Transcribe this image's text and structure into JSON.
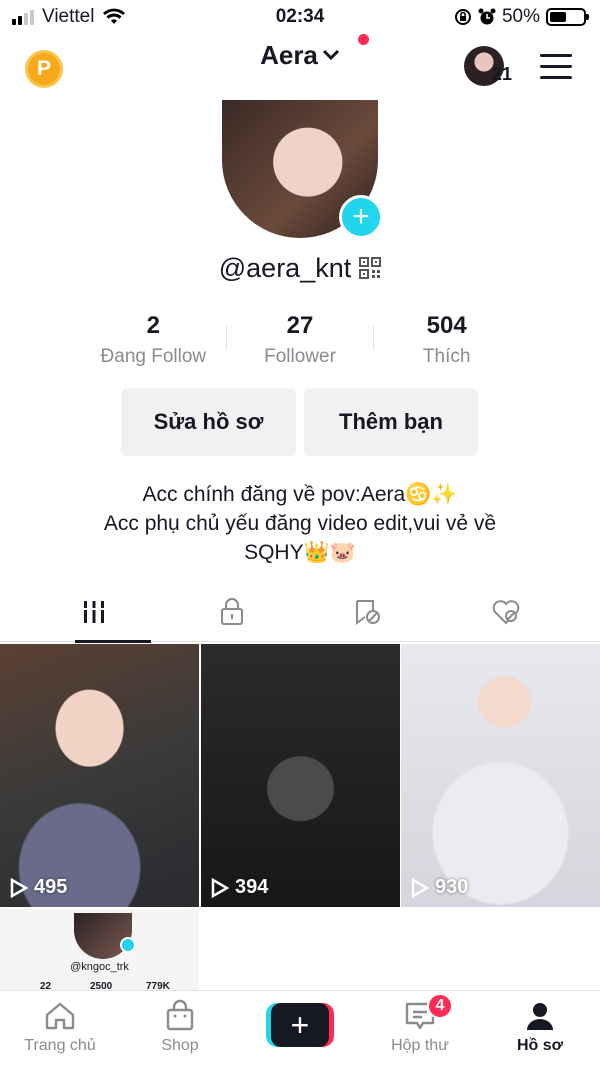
{
  "status_bar": {
    "carrier": "Viettel",
    "time": "02:34",
    "battery": "50%",
    "battery_level": 0.5
  },
  "header": {
    "username": "Aera",
    "notification_count": "21"
  },
  "profile": {
    "handle": "@aera_knt",
    "stats": [
      {
        "value": "2",
        "label": "Đang Follow"
      },
      {
        "value": "27",
        "label": "Follower"
      },
      {
        "value": "504",
        "label": "Thích"
      }
    ],
    "edit_button": "Sửa hồ sơ",
    "add_friend_button": "Thêm bạn",
    "bio": [
      "Acc chính đăng về pov:Aera♋✨",
      "Acc phụ chủ yếu đăng video edit,vui vẻ về",
      "SQHY👑🐷"
    ]
  },
  "tabs": [
    {
      "icon": "videos-grid-icon",
      "active": true
    },
    {
      "icon": "lock-icon",
      "active": false
    },
    {
      "icon": "repost-icon",
      "active": false
    },
    {
      "icon": "liked-hidden-icon",
      "active": false
    }
  ],
  "videos": [
    {
      "views": "495"
    },
    {
      "views": "394"
    },
    {
      "views": "930"
    }
  ],
  "partial_tile": {
    "handle": "@kngoc_trk",
    "stats": [
      "22",
      "2500",
      "779K"
    ]
  },
  "nav": {
    "home": "Trang chủ",
    "shop": "Shop",
    "inbox": "Hộp thư",
    "inbox_badge": "4",
    "profile": "Hồ sơ"
  },
  "colors": {
    "accent_red": "#fe2c55",
    "accent_cyan": "#20d5ec",
    "coin": "#f7a81b"
  }
}
